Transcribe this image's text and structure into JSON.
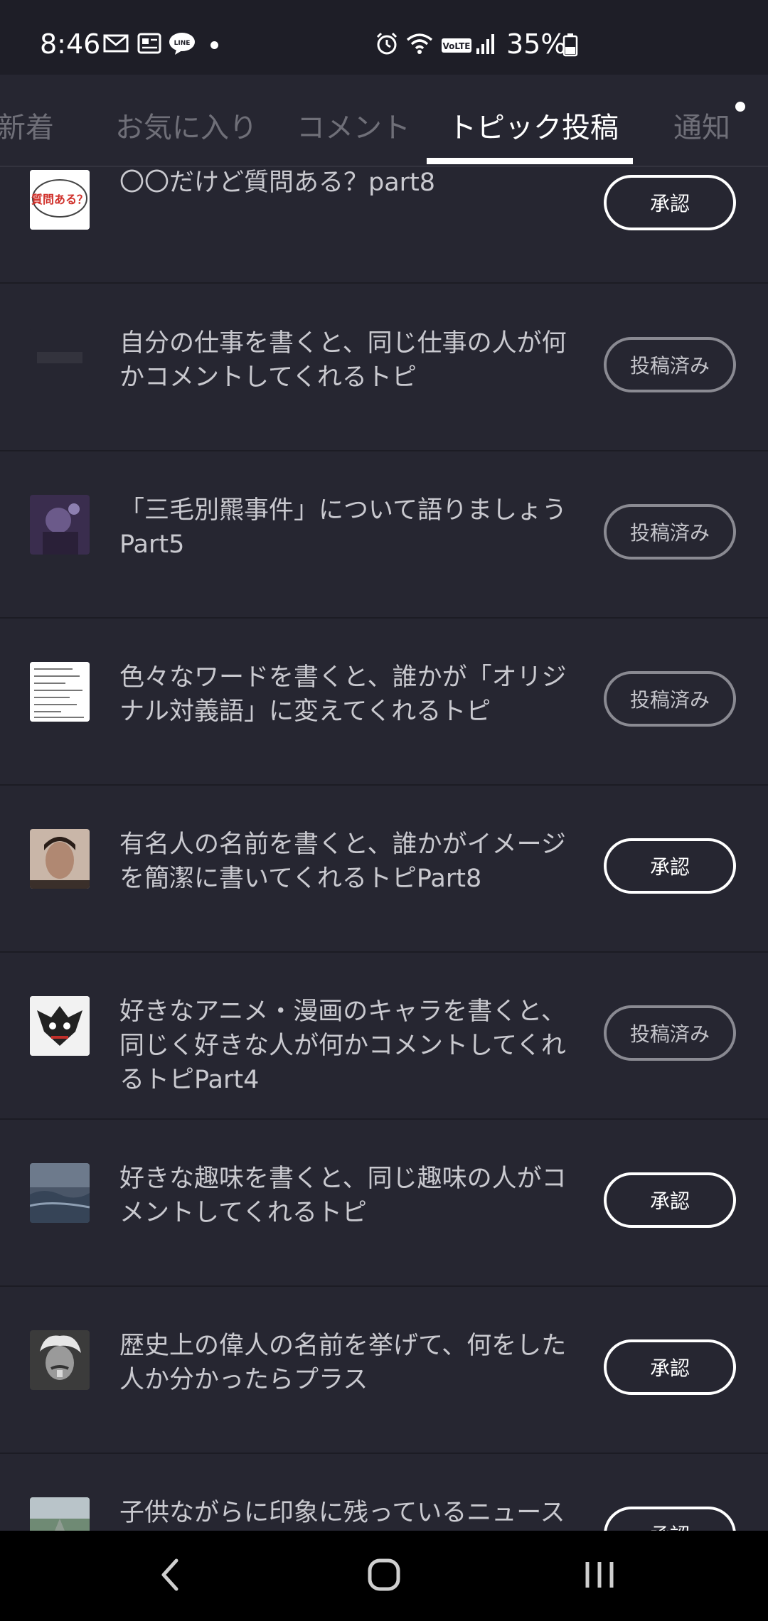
{
  "status_bar": {
    "time": "8:46",
    "battery": "35%",
    "icons": [
      "mail-icon",
      "news-icon",
      "line-icon",
      "alarm-icon",
      "wifi-icon",
      "volte-icon",
      "signal-icon",
      "battery-icon"
    ],
    "line_label": "LINE",
    "volte_label": "VoLTE"
  },
  "tabs": [
    {
      "label": "新着",
      "active": false
    },
    {
      "label": "お気に入り",
      "active": false
    },
    {
      "label": "コメント",
      "active": false
    },
    {
      "label": "トピック投稿",
      "active": true
    },
    {
      "label": "通知",
      "active": false
    }
  ],
  "topics": [
    {
      "title": "〇〇だけど質問ある？part8",
      "button": "承認",
      "state": "approve",
      "thumb_text": "質問ある？"
    },
    {
      "title": "自分の仕事を書くと、同じ仕事の人が何かコメントしてくれるトピ",
      "button": "投稿済み",
      "state": "posted"
    },
    {
      "title": "「三毛別羆事件」について語りましょうPart5",
      "button": "投稿済み",
      "state": "posted"
    },
    {
      "title": "色々なワードを書くと、誰かが「オリジナル対義語」に変えてくれるトピ",
      "button": "投稿済み",
      "state": "posted"
    },
    {
      "title": "有名人の名前を書くと、誰かがイメージを簡潔に書いてくれるトピPart8",
      "button": "承認",
      "state": "approve"
    },
    {
      "title": "好きなアニメ・漫画のキャラを書くと、同じく好きな人が何かコメントしてくれるトピPart4",
      "button": "投稿済み",
      "state": "posted"
    },
    {
      "title": "好きな趣味を書くと、同じ趣味の人がコメントしてくれるトピ",
      "button": "承認",
      "state": "approve"
    },
    {
      "title": "歴史上の偉人の名前を挙げて、何をした人か分かったらプラス",
      "button": "承認",
      "state": "approve"
    },
    {
      "title": "子供ながらに印象に残っているニュース",
      "button": "承認",
      "state": "approve"
    }
  ],
  "colors": {
    "background": "#262631",
    "status_bar": "#1e1e27",
    "active_tab": "#ffffff",
    "inactive_tab": "#6f6f78",
    "posted_border": "#8a8a92"
  },
  "nav_bar": {
    "icons": [
      "back-icon",
      "home-icon",
      "recent-apps-icon"
    ]
  }
}
